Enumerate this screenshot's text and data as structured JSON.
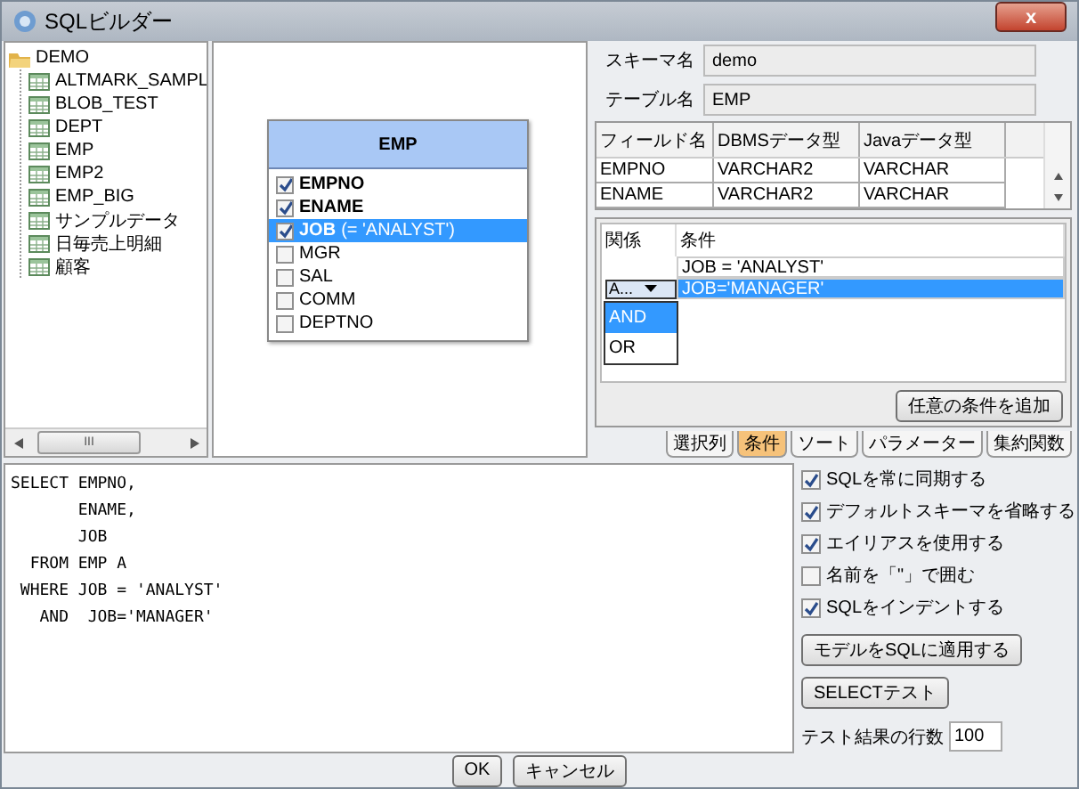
{
  "window": {
    "title": "SQLビルダー",
    "close": "x"
  },
  "tree": {
    "label": "DEMO",
    "children": [
      {
        "label": "ALTMARK_SAMPL"
      },
      {
        "label": "BLOB_TEST"
      },
      {
        "label": "DEPT"
      },
      {
        "label": "EMP"
      },
      {
        "label": "EMP2"
      },
      {
        "label": "EMP_BIG"
      },
      {
        "label": "サンプルデータ"
      },
      {
        "label": "日毎売上明細"
      },
      {
        "label": "顧客"
      }
    ]
  },
  "tree_scrollbar": {
    "grip": "III"
  },
  "entity": {
    "title": "EMP",
    "fields": [
      {
        "name": "EMPNO",
        "checked": true,
        "selected": false
      },
      {
        "name": "ENAME",
        "checked": true,
        "selected": false
      },
      {
        "name": "JOB",
        "condition": "(= 'ANALYST')",
        "checked": true,
        "selected": true
      },
      {
        "name": "MGR",
        "checked": false,
        "selected": false
      },
      {
        "name": "SAL",
        "checked": false,
        "selected": false
      },
      {
        "name": "COMM",
        "checked": false,
        "selected": false
      },
      {
        "name": "DEPTNO",
        "checked": false,
        "selected": false
      }
    ]
  },
  "schema": {
    "label": "スキーマ名",
    "value": "demo"
  },
  "table_name": {
    "label": "テーブル名",
    "value": "EMP"
  },
  "field_table": {
    "columns": [
      "フィールド名",
      "DBMSデータ型",
      "Javaデータ型"
    ],
    "rows": [
      [
        "EMPNO",
        "VARCHAR2",
        "VARCHAR"
      ],
      [
        "ENAME",
        "VARCHAR2",
        "VARCHAR"
      ]
    ]
  },
  "conditions": {
    "columns": [
      "関係",
      "条件"
    ],
    "rows": [
      {
        "relation": "",
        "condition": "JOB = 'ANALYST'",
        "selected": false
      },
      {
        "relation": "A...",
        "condition": "JOB='MANAGER'",
        "selected": true
      }
    ],
    "dropdown": [
      {
        "label": "AND",
        "selected": true
      },
      {
        "label": "OR",
        "selected": false
      }
    ],
    "add_button": "任意の条件を追加"
  },
  "tabs": [
    {
      "label": "選択列",
      "selected": false
    },
    {
      "label": "条件",
      "selected": true
    },
    {
      "label": "ソート",
      "selected": false
    },
    {
      "label": "パラメーター",
      "selected": false
    },
    {
      "label": "集約関数",
      "selected": false
    }
  ],
  "sql_lines": [
    "SELECT EMPNO,",
    "       ENAME,",
    "       JOB",
    "  FROM EMP A",
    " WHERE JOB = 'ANALYST'",
    "   AND  JOB='MANAGER'"
  ],
  "options": [
    {
      "label": "SQLを常に同期する",
      "checked": true
    },
    {
      "label": "デフォルトスキーマを省略する",
      "checked": true
    },
    {
      "label": "エイリアスを使用する",
      "checked": true
    },
    {
      "label": "名前を「\"」で囲む",
      "checked": false
    },
    {
      "label": "SQLをインデントする",
      "checked": true
    }
  ],
  "apply_button": "モデルをSQLに適用する",
  "test_button": "SELECTテスト",
  "result_rows": {
    "label": "テスト結果の行数",
    "value": "100"
  },
  "buttons": [
    "OK",
    "キャンセル"
  ]
}
